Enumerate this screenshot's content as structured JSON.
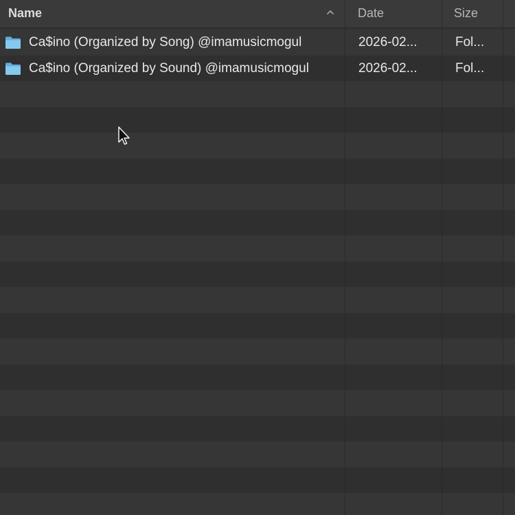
{
  "columns": {
    "name": "Name",
    "date": "Date",
    "size": "Size"
  },
  "sort": {
    "column": "name",
    "direction": "ascending",
    "icon": "chevron-up-icon"
  },
  "files": [
    {
      "name": "Ca$ino (Organized by Song) @imamusicmogul",
      "date": "2026-02...",
      "size": "Fol...",
      "icon": "folder-icon"
    },
    {
      "name": "Ca$ino (Organized by Sound) @imamusicmogul",
      "date": "2026-02...",
      "size": "Fol...",
      "icon": "folder-icon"
    }
  ],
  "colors": {
    "background": "#323232",
    "header": "#3a3a3a",
    "row_alt": "#363636",
    "folder": "#7fc4ea",
    "text": "#e8e8e8"
  }
}
